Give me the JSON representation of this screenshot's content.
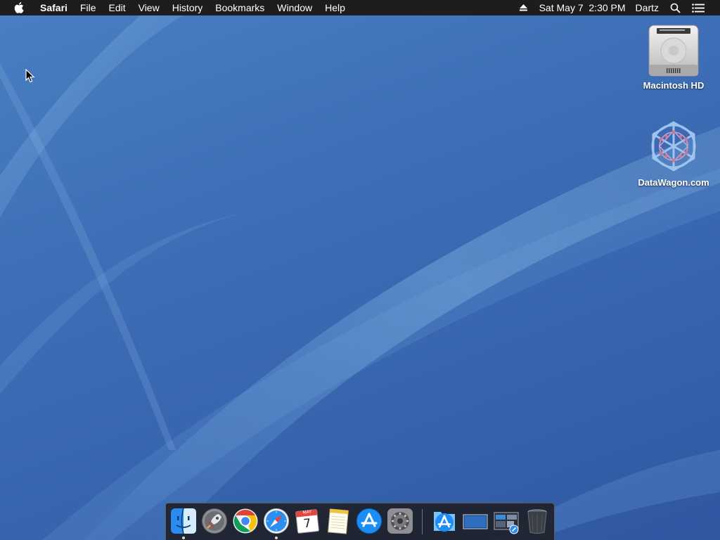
{
  "menubar": {
    "app_name": "Safari",
    "items": [
      "File",
      "Edit",
      "View",
      "History",
      "Bookmarks",
      "Window",
      "Help"
    ],
    "datetime": "Sat May 7  2:30 PM",
    "user": "Dartz"
  },
  "desktop": {
    "icons": [
      {
        "label": "Macintosh HD",
        "icon": "hard-drive-icon"
      },
      {
        "label": "DataWagon.com",
        "icon": "datawagon-volume-icon"
      }
    ]
  },
  "dock": {
    "apps": [
      {
        "name": "Finder",
        "icon": "finder-icon",
        "running": true
      },
      {
        "name": "Launchpad",
        "icon": "launchpad-icon",
        "running": false
      },
      {
        "name": "Google Chrome",
        "icon": "chrome-icon",
        "running": false
      },
      {
        "name": "Safari",
        "icon": "safari-icon",
        "running": true
      },
      {
        "name": "Calendar",
        "icon": "calendar-icon",
        "running": false
      },
      {
        "name": "Notes",
        "icon": "notes-icon",
        "running": false
      },
      {
        "name": "App Store",
        "icon": "app-store-icon",
        "running": false
      },
      {
        "name": "System Preferences",
        "icon": "system-preferences-icon",
        "running": false
      }
    ],
    "others": [
      {
        "name": "Applications",
        "icon": "applications-folder-icon"
      },
      {
        "name": "Desktop",
        "icon": "desktop-stack-icon"
      },
      {
        "name": "Downloads",
        "icon": "downloads-stack-icon"
      },
      {
        "name": "Trash",
        "icon": "trash-icon"
      }
    ],
    "calendar": {
      "month": "MAY",
      "day": "7"
    }
  },
  "colors": {
    "menubar_bg": "#1d1d1f",
    "desktop_blue": "#3d6db5"
  }
}
